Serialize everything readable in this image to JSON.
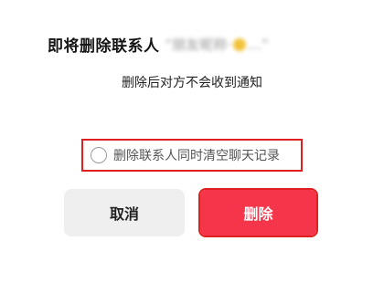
{
  "dialog": {
    "title": "即将删除联系人",
    "contact_name_blurred": "“朋友昵称·",
    "contact_name_suffix": "…”",
    "subtitle": "删除后对方不会收到通知",
    "option": {
      "label": "删除联系人同时清空聊天记录",
      "checked": false
    },
    "buttons": {
      "cancel": "取消",
      "delete": "删除"
    }
  },
  "colors": {
    "delete_button": "#f5364a",
    "cancel_button": "#efefef",
    "highlight": "#e02020"
  }
}
